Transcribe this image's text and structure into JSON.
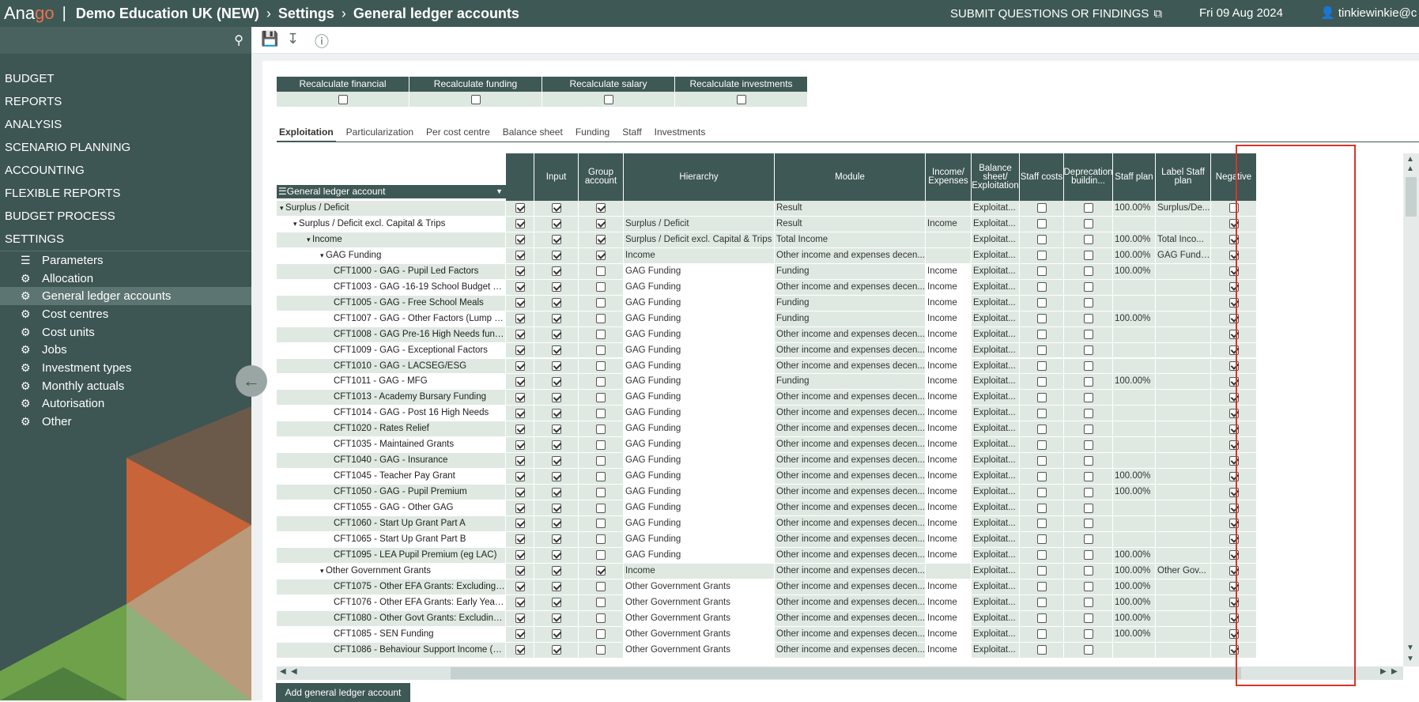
{
  "topbar": {
    "logo_a": "Ana",
    "logo_go": "go",
    "company": "Demo Education UK (NEW)",
    "crumb_settings": "Settings",
    "crumb_page": "General ledger accounts",
    "submit": "SUBMIT QUESTIONS OR FINDINGS",
    "date": "Fri 09 Aug 2024",
    "user": "tinkiewinkie@c"
  },
  "sidebar": {
    "menu": [
      "BUDGET",
      "REPORTS",
      "ANALYSIS",
      "SCENARIO PLANNING",
      "ACCOUNTING",
      "FLEXIBLE REPORTS",
      "BUDGET PROCESS",
      "SETTINGS"
    ],
    "submenu": [
      "Parameters",
      "Allocation",
      "General ledger accounts",
      "Cost centres",
      "Cost units",
      "Jobs",
      "Investment types",
      "Monthly actuals",
      "Autorisation",
      "Other"
    ],
    "active": "General ledger accounts"
  },
  "recalc": [
    {
      "label": "Recalculate financial"
    },
    {
      "label": "Recalculate funding"
    },
    {
      "label": "Recalculate salary"
    },
    {
      "label": "Recalculate investments"
    }
  ],
  "tabs": [
    "Exploitation",
    "Particularization",
    "Per cost centre",
    "Balance sheet",
    "Funding",
    "Staff",
    "Investments"
  ],
  "grid": {
    "gl_header": "General ledger account",
    "headers": {
      "input": "Input",
      "group": "Group account",
      "hierarchy": "Hierarchy",
      "module": "Module",
      "incexp": "Income/ Expenses",
      "balance": "Balance sheet/ Exploitation",
      "staffcosts": "Staff costs",
      "depr": "Deprecation buildin...",
      "staffplan": "Staff plan",
      "labelstaff": "Label Staff plan",
      "negative": "Negative"
    },
    "rows": [
      {
        "name": "Surplus / Deficit",
        "lvl": 0,
        "exp": true,
        "g": true,
        "hier": "",
        "mod": "Result",
        "inc": "",
        "bal": "Exploitat...",
        "sp": "100.00%",
        "lbl": "Surplus/De...",
        "neg": false
      },
      {
        "name": "Surplus / Deficit excl. Capital & Trips",
        "lvl": 1,
        "exp": true,
        "g": true,
        "hier": "Surplus / Deficit",
        "mod": "Result",
        "inc": "Income",
        "bal": "Exploitat...",
        "sp": "",
        "lbl": "",
        "neg": true
      },
      {
        "name": "Income",
        "lvl": 2,
        "exp": true,
        "g": true,
        "hier": "Surplus / Deficit excl. Capital & Trips",
        "mod": "Total Income",
        "inc": "",
        "bal": "Exploitat...",
        "sp": "100.00%",
        "lbl": "Total Inco...",
        "neg": true
      },
      {
        "name": "GAG Funding",
        "lvl": 3,
        "exp": true,
        "g": true,
        "hier": "Income",
        "mod": "Other income and expenses decen...",
        "inc": "",
        "bal": "Exploitat...",
        "sp": "100.00%",
        "lbl": "GAG Fundi...",
        "neg": true
      },
      {
        "name": "CFT1000 - GAG - Pupil Led Factors",
        "lvl": 4,
        "g": false,
        "hier": "GAG Funding",
        "mod": "Funding",
        "inc": "Income",
        "bal": "Exploitat...",
        "sp": "100.00%",
        "lbl": "",
        "neg": true
      },
      {
        "name": "CFT1003 - GAG -16-19 School Budget Sha...",
        "lvl": 4,
        "g": false,
        "hier": "GAG Funding",
        "mod": "Other income and expenses decen...",
        "inc": "Income",
        "bal": "Exploitat...",
        "sp": "",
        "lbl": "",
        "neg": true
      },
      {
        "name": "CFT1005 - GAG - Free School Meals",
        "lvl": 4,
        "g": false,
        "hier": "GAG Funding",
        "mod": "Funding",
        "inc": "Income",
        "bal": "Exploitat...",
        "sp": "",
        "lbl": "",
        "neg": true
      },
      {
        "name": "CFT1007 - GAG - Other Factors (Lump Sum)",
        "lvl": 4,
        "g": false,
        "hier": "GAG Funding",
        "mod": "Funding",
        "inc": "Income",
        "bal": "Exploitat...",
        "sp": "100.00%",
        "lbl": "",
        "neg": true
      },
      {
        "name": "CFT1008 - GAG Pre-16 High Needs funding",
        "lvl": 4,
        "g": false,
        "hier": "GAG Funding",
        "mod": "Other income and expenses decen...",
        "inc": "Income",
        "bal": "Exploitat...",
        "sp": "",
        "lbl": "",
        "neg": true
      },
      {
        "name": "CFT1009 - GAG - Exceptional Factors",
        "lvl": 4,
        "g": false,
        "hier": "GAG Funding",
        "mod": "Other income and expenses decen...",
        "inc": "Income",
        "bal": "Exploitat...",
        "sp": "",
        "lbl": "",
        "neg": true
      },
      {
        "name": "CFT1010 - GAG - LACSEG/ESG",
        "lvl": 4,
        "g": false,
        "hier": "GAG Funding",
        "mod": "Other income and expenses decen...",
        "inc": "Income",
        "bal": "Exploitat...",
        "sp": "",
        "lbl": "",
        "neg": true
      },
      {
        "name": "CFT1011 - GAG - MFG",
        "lvl": 4,
        "g": false,
        "hier": "GAG Funding",
        "mod": "Funding",
        "inc": "Income",
        "bal": "Exploitat...",
        "sp": "100.00%",
        "lbl": "",
        "neg": true
      },
      {
        "name": "CFT1013 - Academy Bursary Funding",
        "lvl": 4,
        "g": false,
        "hier": "GAG Funding",
        "mod": "Other income and expenses decen...",
        "inc": "Income",
        "bal": "Exploitat...",
        "sp": "",
        "lbl": "",
        "neg": true
      },
      {
        "name": "CFT1014 - GAG - Post 16 High Needs",
        "lvl": 4,
        "g": false,
        "hier": "GAG Funding",
        "mod": "Other income and expenses decen...",
        "inc": "Income",
        "bal": "Exploitat...",
        "sp": "",
        "lbl": "",
        "neg": true
      },
      {
        "name": "CFT1020 - Rates Relief",
        "lvl": 4,
        "g": false,
        "hier": "GAG Funding",
        "mod": "Other income and expenses decen...",
        "inc": "Income",
        "bal": "Exploitat...",
        "sp": "",
        "lbl": "",
        "neg": true
      },
      {
        "name": "CFT1035 - Maintained Grants",
        "lvl": 4,
        "g": false,
        "hier": "GAG Funding",
        "mod": "Other income and expenses decen...",
        "inc": "Income",
        "bal": "Exploitat...",
        "sp": "",
        "lbl": "",
        "neg": true
      },
      {
        "name": "CFT1040 - GAG - Insurance",
        "lvl": 4,
        "g": false,
        "hier": "GAG Funding",
        "mod": "Other income and expenses decen...",
        "inc": "Income",
        "bal": "Exploitat...",
        "sp": "",
        "lbl": "",
        "neg": true
      },
      {
        "name": "CFT1045 - Teacher Pay Grant",
        "lvl": 4,
        "g": false,
        "hier": "GAG Funding",
        "mod": "Other income and expenses decen...",
        "inc": "Income",
        "bal": "Exploitat...",
        "sp": "100.00%",
        "lbl": "",
        "neg": true
      },
      {
        "name": "CFT1050 - GAG - Pupil Premium",
        "lvl": 4,
        "g": false,
        "hier": "GAG Funding",
        "mod": "Other income and expenses decen...",
        "inc": "Income",
        "bal": "Exploitat...",
        "sp": "100.00%",
        "lbl": "",
        "neg": true
      },
      {
        "name": "CFT1055 - GAG - Other GAG",
        "lvl": 4,
        "g": false,
        "hier": "GAG Funding",
        "mod": "Other income and expenses decen...",
        "inc": "Income",
        "bal": "Exploitat...",
        "sp": "",
        "lbl": "",
        "neg": true
      },
      {
        "name": "CFT1060 - Start Up Grant Part A",
        "lvl": 4,
        "g": false,
        "hier": "GAG Funding",
        "mod": "Other income and expenses decen...",
        "inc": "Income",
        "bal": "Exploitat...",
        "sp": "",
        "lbl": "",
        "neg": true
      },
      {
        "name": "CFT1065 - Start Up Grant Part B",
        "lvl": 4,
        "g": false,
        "hier": "GAG Funding",
        "mod": "Other income and expenses decen...",
        "inc": "Income",
        "bal": "Exploitat...",
        "sp": "",
        "lbl": "",
        "neg": true
      },
      {
        "name": "CFT1095 - LEA Pupil Premium (eg LAC)",
        "lvl": 4,
        "g": false,
        "hier": "GAG Funding",
        "mod": "Other income and expenses decen...",
        "inc": "Income",
        "bal": "Exploitat...",
        "sp": "100.00%",
        "lbl": "",
        "neg": true
      },
      {
        "name": "Other Government Grants",
        "lvl": 3,
        "exp": true,
        "g": true,
        "hier": "Income",
        "mod": "Other income and expenses decen...",
        "inc": "",
        "bal": "Exploitat...",
        "sp": "100.00%",
        "lbl": "Other Gov...",
        "neg": true
      },
      {
        "name": "CFT1075 - Other EFA Grants: Excluding Ca...",
        "lvl": 4,
        "g": false,
        "hier": "Other Government Grants",
        "mod": "Other income and expenses decen...",
        "inc": "Income",
        "bal": "Exploitat...",
        "sp": "100.00%",
        "lbl": "",
        "neg": true
      },
      {
        "name": "CFT1076 - Other EFA Grants: Early Years G...",
        "lvl": 4,
        "g": false,
        "hier": "Other Government Grants",
        "mod": "Other income and expenses decen...",
        "inc": "Income",
        "bal": "Exploitat...",
        "sp": "100.00%",
        "lbl": "",
        "neg": true
      },
      {
        "name": "CFT1080 - Other Govt Grants: Excluding C...",
        "lvl": 4,
        "g": false,
        "hier": "Other Government Grants",
        "mod": "Other income and expenses decen...",
        "inc": "Income",
        "bal": "Exploitat...",
        "sp": "100.00%",
        "lbl": "",
        "neg": true
      },
      {
        "name": "CFT1085 - SEN Funding",
        "lvl": 4,
        "g": false,
        "hier": "Other Government Grants",
        "mod": "Other income and expenses decen...",
        "inc": "Income",
        "bal": "Exploitat...",
        "sp": "100.00%",
        "lbl": "",
        "neg": true
      },
      {
        "name": "CFT1086 - Behaviour Support Income (BS...",
        "lvl": 4,
        "g": false,
        "hier": "Other Government Grants",
        "mod": "Other income and expenses decen...",
        "inc": "Income",
        "bal": "Exploitat...",
        "sp": "",
        "lbl": "",
        "neg": true
      }
    ]
  },
  "add_button": "Add general ledger account"
}
